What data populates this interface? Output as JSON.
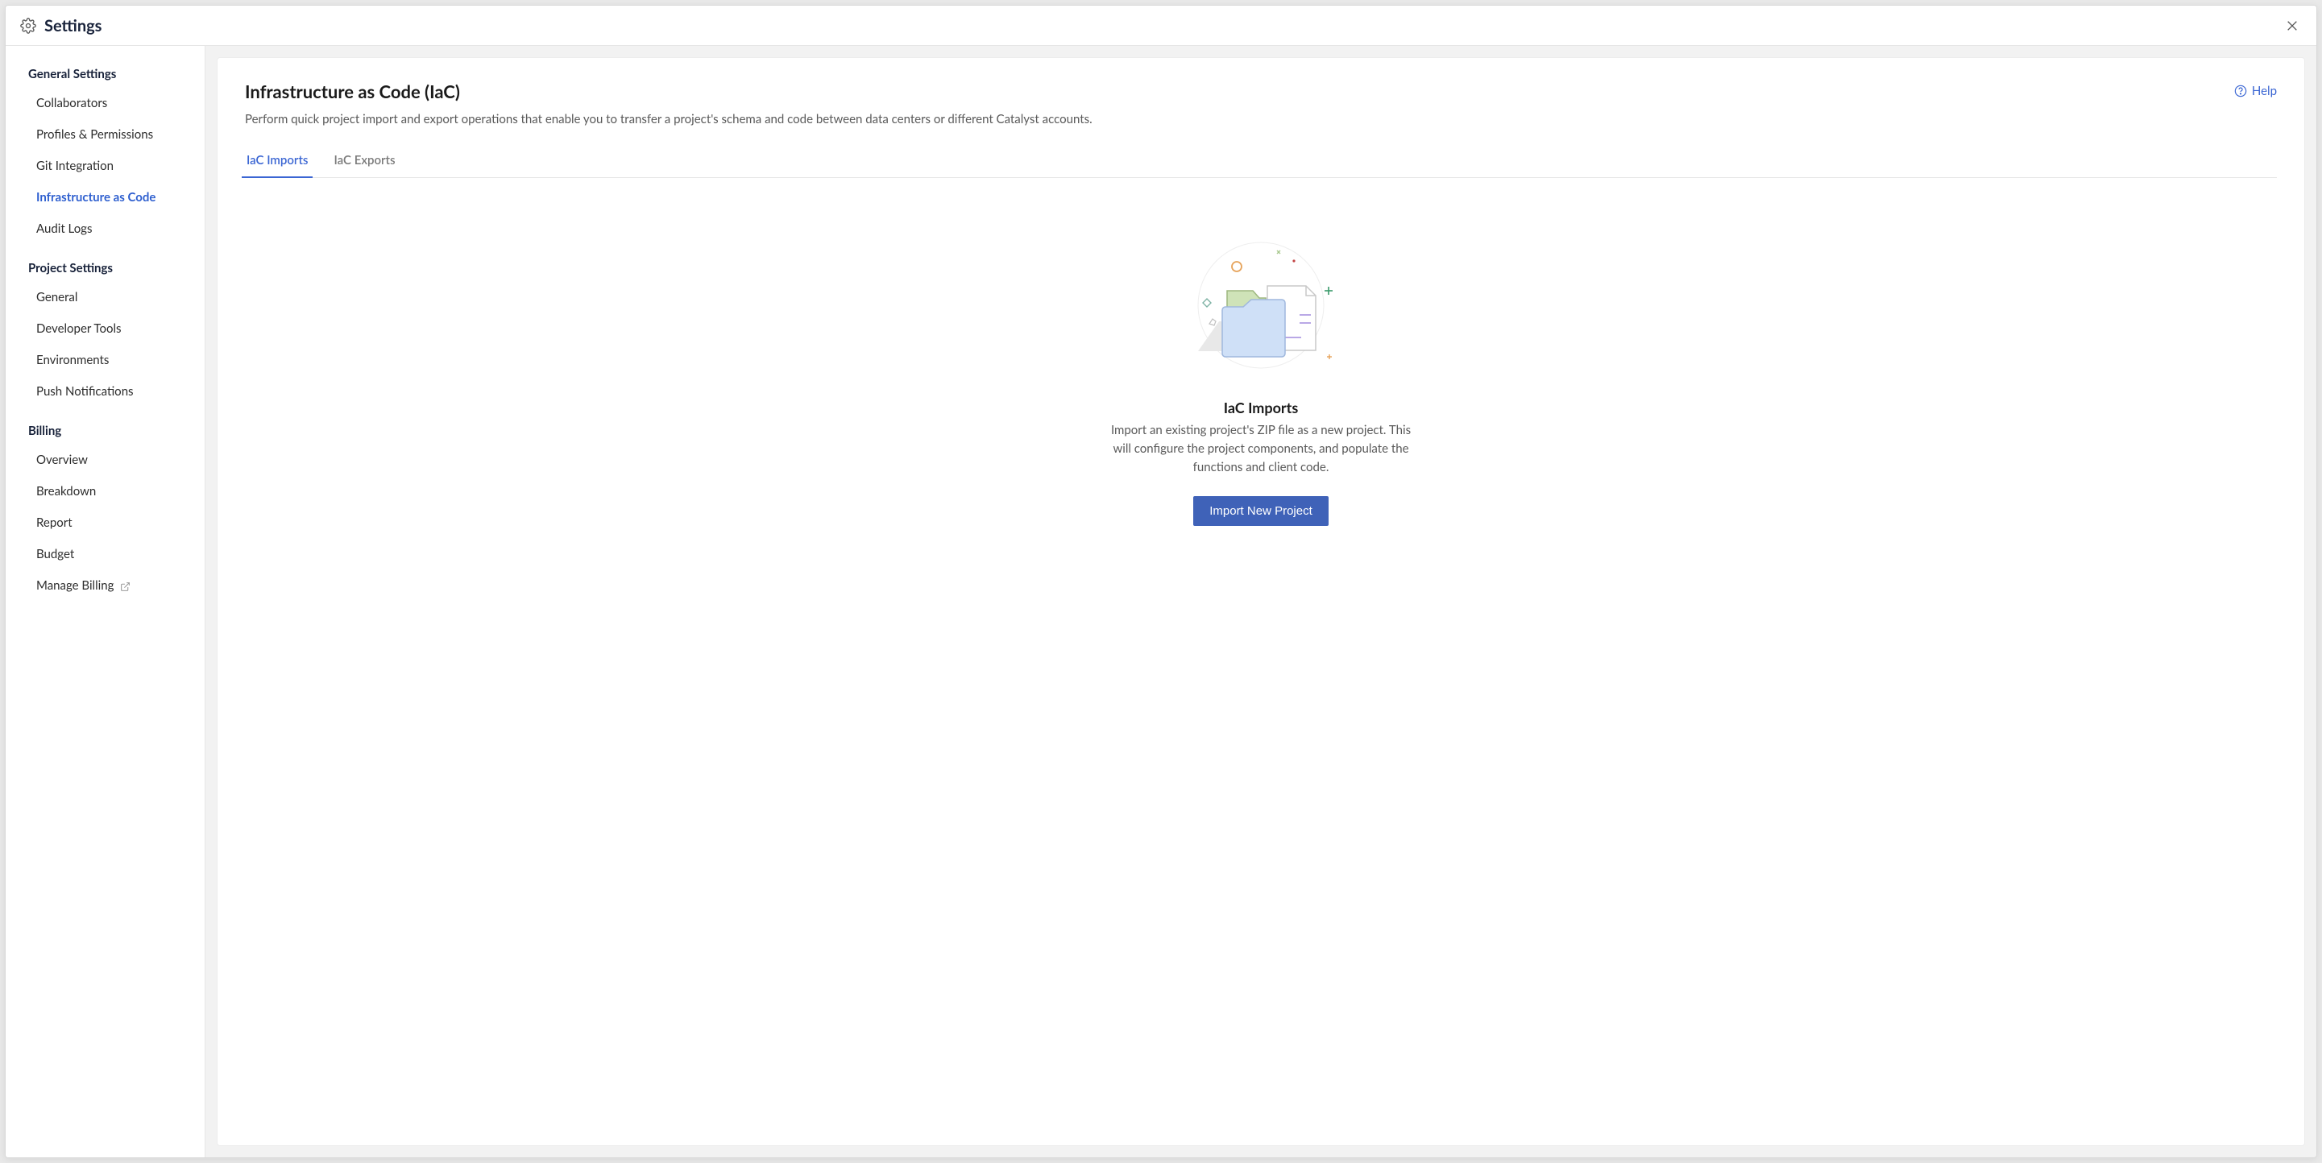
{
  "header": {
    "title": "Settings"
  },
  "sidebar": {
    "sections": [
      {
        "title": "General Settings",
        "items": [
          {
            "label": "Collaborators",
            "active": false
          },
          {
            "label": "Profiles & Permissions",
            "active": false
          },
          {
            "label": "Git Integration",
            "active": false
          },
          {
            "label": "Infrastructure as Code",
            "active": true
          },
          {
            "label": "Audit Logs",
            "active": false
          }
        ]
      },
      {
        "title": "Project Settings",
        "items": [
          {
            "label": "General",
            "active": false
          },
          {
            "label": "Developer Tools",
            "active": false
          },
          {
            "label": "Environments",
            "active": false
          },
          {
            "label": "Push Notifications",
            "active": false
          }
        ]
      },
      {
        "title": "Billing",
        "items": [
          {
            "label": "Overview",
            "active": false
          },
          {
            "label": "Breakdown",
            "active": false
          },
          {
            "label": "Report",
            "active": false
          },
          {
            "label": "Budget",
            "active": false
          },
          {
            "label": "Manage Billing",
            "active": false,
            "external": true
          }
        ]
      }
    ]
  },
  "main": {
    "title": "Infrastructure as Code (IaC)",
    "description": "Perform quick project import and export operations that enable you to transfer a project's schema and code between data centers or different Catalyst accounts.",
    "help_label": "Help",
    "tabs": [
      {
        "label": "IaC Imports",
        "active": true
      },
      {
        "label": "IaC Exports",
        "active": false
      }
    ],
    "empty": {
      "title": "IaC Imports",
      "description": "Import an existing project's ZIP file as a new project. This will configure the project components, and populate the functions and client code.",
      "button_label": "Import New Project"
    }
  }
}
